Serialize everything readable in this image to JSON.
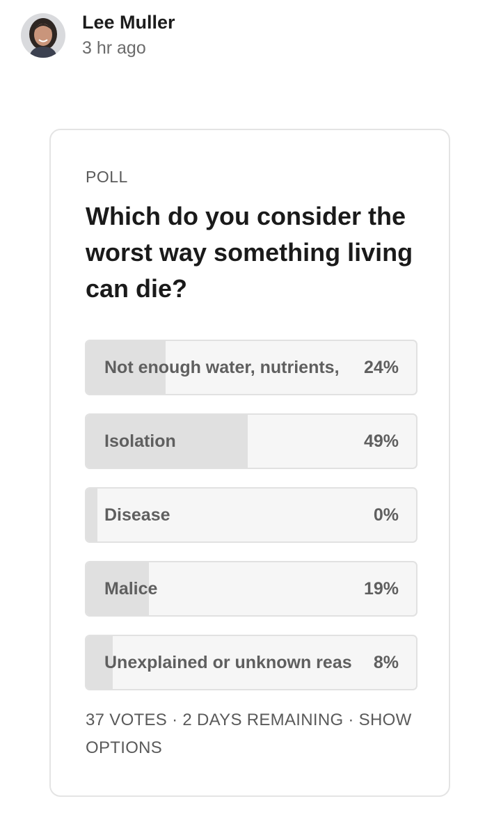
{
  "post": {
    "author": "Lee Muller",
    "timestamp": "3 hr ago"
  },
  "poll": {
    "label": "POLL",
    "question": "Which do you consider the worst way something living can die?",
    "options": [
      {
        "label": "Not enough water, nutrients,",
        "percent_text": "24%",
        "percent": 24
      },
      {
        "label": "Isolation",
        "percent_text": "49%",
        "percent": 49
      },
      {
        "label": "Disease",
        "percent_text": "0%",
        "percent": 0
      },
      {
        "label": "Malice",
        "percent_text": "19%",
        "percent": 19
      },
      {
        "label": "Unexplained or unknown reas",
        "percent_text": "8%",
        "percent": 8
      }
    ],
    "footer": {
      "votes": "37 VOTES",
      "separator": " · ",
      "remaining": "2 DAYS REMAINING",
      "show_options": "SHOW OPTIONS"
    }
  },
  "colors": {
    "bar_fill": "#e0e0e0",
    "bar_background": "#f6f6f6",
    "card_border": "#e4e4e4"
  }
}
